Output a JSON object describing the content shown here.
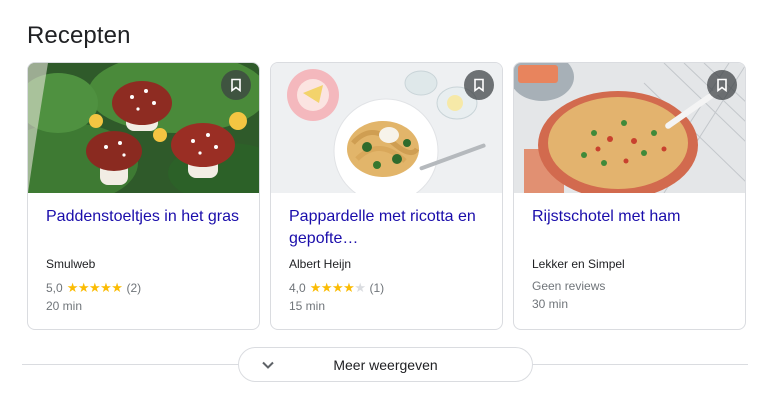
{
  "section": {
    "title": "Recepten"
  },
  "cards": [
    {
      "title": "Paddenstoeltjes in het gras",
      "source": "Smulweb",
      "rating": "5,0",
      "reviews": "(2)",
      "time": "20 min"
    },
    {
      "title": "Pappardelle met ricotta en gepofte…",
      "source": "Albert Heijn",
      "rating": "4,0",
      "reviews": "(1)",
      "time": "15 min"
    },
    {
      "title": "Rijstschotel met ham",
      "source": "Lekker en Simpel",
      "no_reviews": "Geen reviews",
      "time": "30 min"
    }
  ],
  "stars": {
    "on": "★★★★★",
    "four_on": "★★★★",
    "four_off": "★"
  },
  "more": {
    "label": "Meer weergeven"
  },
  "icons": {
    "bookmark": "bookmark-icon",
    "chevron": "chevron-down-icon"
  },
  "colors": {
    "link": "#1a0dab",
    "star": "#fbbc04",
    "border": "#dadce0"
  }
}
